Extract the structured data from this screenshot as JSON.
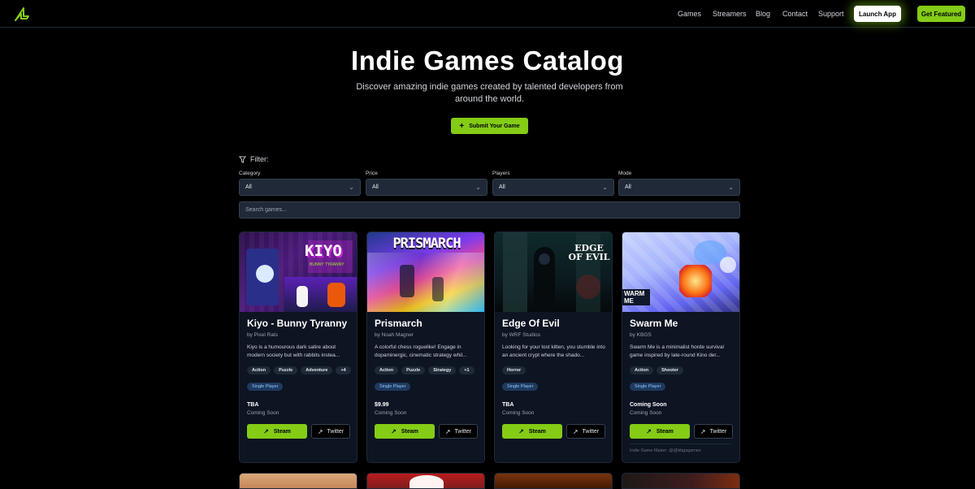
{
  "nav": {
    "links": [
      "Games",
      "Streamers",
      "Blog",
      "Contact",
      "Support"
    ],
    "launch_label": "Launch App",
    "featured_label": "Get Featured",
    "accent": "#84cc16"
  },
  "hero": {
    "title": "Indie Games Catalog",
    "subtitle": "Discover amazing indie games created by talented developers from around the world.",
    "submit_label": "Submit Your Game"
  },
  "filters": {
    "label": "Filter:",
    "fields": [
      {
        "label": "Category",
        "value": "All"
      },
      {
        "label": "Price",
        "value": "All"
      },
      {
        "label": "Players",
        "value": "All"
      },
      {
        "label": "Mode",
        "value": "All"
      }
    ],
    "search_placeholder": "Search games..."
  },
  "games": [
    {
      "title": "Kiyo - Bunny Tyranny",
      "by": "by Pixel Rats",
      "desc": "Kiyo is a humourous dark satire about modern society but with rabbits instea...",
      "tags": [
        "Action",
        "Puzzle",
        "Adventure",
        "+4"
      ],
      "mode": "Single Player",
      "price": "TBA",
      "release": "Coming Soon",
      "steam": "Steam",
      "twitter": "Twitter",
      "image_text": "KIYO",
      "image_sub": "BUNNY TYRANNY"
    },
    {
      "title": "Prismarch",
      "by": "by Noah Magner",
      "desc": "A colorful chess roguelike! Engage in dopaminergic, cinematic strategy whil...",
      "tags": [
        "Action",
        "Puzzle",
        "Strategy",
        "+1"
      ],
      "mode": "Single Player",
      "price": "$9.99",
      "release": "Coming Soon",
      "steam": "Steam",
      "twitter": "Twitter",
      "image_text": "PRISMARCH"
    },
    {
      "title": "Edge Of Evil",
      "by": "by WRF Studios",
      "desc": "Looking for your lost kitten, you stumble into an ancient crypt where the shado...",
      "tags": [
        "Horror"
      ],
      "mode": "Single Player",
      "price": "TBA",
      "release": "Coming Soon",
      "steam": "Steam",
      "twitter": "Twitter",
      "image_text": "EDGE OF EVIL"
    },
    {
      "title": "Swarm Me",
      "by": "by KBGS",
      "desc": "Swarm Me is a minimalist horde survival game inspired by late-round Kino der...",
      "tags": [
        "Action",
        "Shooter"
      ],
      "mode": "Single Player",
      "price": "Coming Soon",
      "release": "Coming Soon",
      "steam": "Steam",
      "twitter": "Twitter",
      "maker": "Indie Game Maker: @@kbgsgames",
      "image_text": "WARM ME"
    }
  ]
}
